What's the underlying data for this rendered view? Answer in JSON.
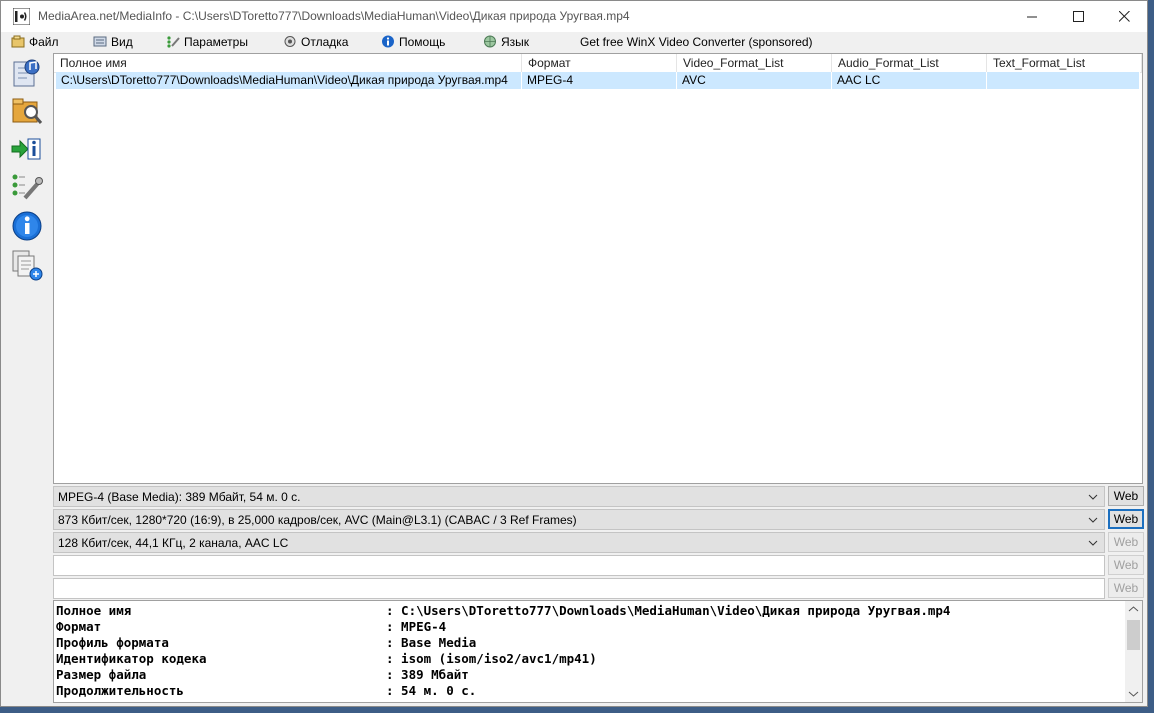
{
  "window": {
    "title": "MediaArea.net/MediaInfo - C:\\Users\\DToretto777\\Downloads\\MediaHuman\\Video\\Дикая природа Уругвая.mp4"
  },
  "menu": [
    {
      "label": "Файл",
      "icon": "file-menu-icon"
    },
    {
      "label": "Вид",
      "icon": "view-menu-icon"
    },
    {
      "label": "Параметры",
      "icon": "options-menu-icon"
    },
    {
      "label": "Отладка",
      "icon": "debug-menu-icon"
    },
    {
      "label": "Помощь",
      "icon": "help-menu-icon"
    },
    {
      "label": "Язык",
      "icon": "language-menu-icon"
    },
    {
      "label": "Get free WinX Video Converter (sponsored)"
    }
  ],
  "toolbar": [
    "open-file-icon",
    "open-folder-icon",
    "export-icon",
    "preferences-icon",
    "about-icon",
    "donate-icon"
  ],
  "filelist": {
    "columns": [
      "Полное имя",
      "Формат",
      "Video_Format_List",
      "Audio_Format_List",
      "Text_Format_List"
    ],
    "rows": [
      [
        "C:\\Users\\DToretto777\\Downloads\\MediaHuman\\Video\\Дикая природа Уругвая.mp4",
        "MPEG-4",
        "AVC",
        "AAC LC",
        ""
      ]
    ]
  },
  "summary": [
    {
      "text": "MPEG-4 (Base Media): 389 Мбайт, 54 м. 0 с.",
      "web": "Web"
    },
    {
      "text": "873 Кбит/сек, 1280*720 (16:9), в 25,000 кадров/сек, AVC (Main@L3.1) (CABAC / 3 Ref Frames)",
      "web": "Web"
    },
    {
      "text": "128 Кбит/сек, 44,1 КГц, 2 канала, AAC LC",
      "web": "Web"
    },
    {
      "text": "",
      "web": "Web"
    },
    {
      "text": "",
      "web": "Web"
    }
  ],
  "details": [
    {
      "label": "Полное имя",
      "value": ": C:\\Users\\DToretto777\\Downloads\\MediaHuman\\Video\\Дикая природа Уругвая.mp4"
    },
    {
      "label": "Формат",
      "value": ": MPEG-4"
    },
    {
      "label": "Профиль формата",
      "value": ": Base Media"
    },
    {
      "label": "Идентификатор кодека",
      "value": ": isom (isom/iso2/avc1/mp41)"
    },
    {
      "label": "Размер файла",
      "value": ": 389 Мбайт"
    },
    {
      "label": "Продолжительность",
      "value": ": 54 м. 0 с."
    }
  ],
  "colors": {
    "selection": "#cce8ff",
    "accent": "#1c6fbf"
  }
}
